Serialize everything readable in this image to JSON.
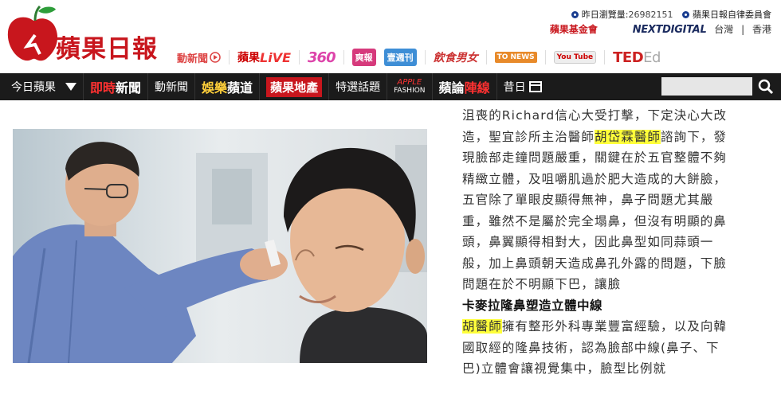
{
  "site": {
    "logo_text": "蘋果日報",
    "brand_color": "#c8161d"
  },
  "top_links": {
    "visitors_label": "昨日瀏覽量:",
    "visitors_count": "26982151",
    "ethics_committee": "蘋果日報自律委員會",
    "fund": "蘋果基金會",
    "nextdigital": "NEXTDIGITAL",
    "region_tw": "台灣",
    "region_divider": "|",
    "region_hk": "香港"
  },
  "channels": {
    "motion": "動新聞",
    "live_prefix": "蘋果",
    "live": "LiVE",
    "c360": "360",
    "box1": "爽報",
    "box2": "壹週刊",
    "food": "飲食男女",
    "news": "TO NEWS",
    "youtube": "You Tube",
    "ted": "TED",
    "ted_suffix": "Ed"
  },
  "nav": {
    "today": "今日蘋果",
    "breaking_red": "即時",
    "breaking": "新聞",
    "motion": "動新聞",
    "ent_yellow": "娛樂",
    "ent": "蘋道",
    "property": "蘋果地產",
    "topics": "特選話題",
    "fashion_brand": "APPLE",
    "fashion": "FASHION",
    "opinion": "蘋論",
    "opinion_red": "陣線",
    "yesterday": "昔日",
    "search_placeholder": ""
  },
  "article": {
    "p1_a": "沮喪的Richard信心大受打擊，下定決心大改造，聖宜診所主治醫師",
    "p1_doctor": "胡岱霖醫師",
    "p1_b": "諮詢下，發現臉部走鐘問題嚴重，關鍵在於五官整體不夠精緻立體，及咀嚼肌過於肥大造成的大餅臉，五官除了單眼皮顯得無神，鼻子問題尤其嚴重，雖然不是屬於完全塌鼻，但沒有明顯的鼻頭，鼻翼顯得相對大，因此鼻型如同蒜頭一般，加上鼻頭朝天造成鼻孔外露的問題，下臉問題在於不明顯下巴，讓臉",
    "subhead": "卡麥拉隆鼻塑造立體中線",
    "p2_doctor": "胡醫師",
    "p2_b": "擁有整形外科專業豐富經驗，以及向韓國取經的隆鼻技術，認為臉部中線(鼻子、下巴)立體會讓視覺集中，臉型比例就"
  }
}
